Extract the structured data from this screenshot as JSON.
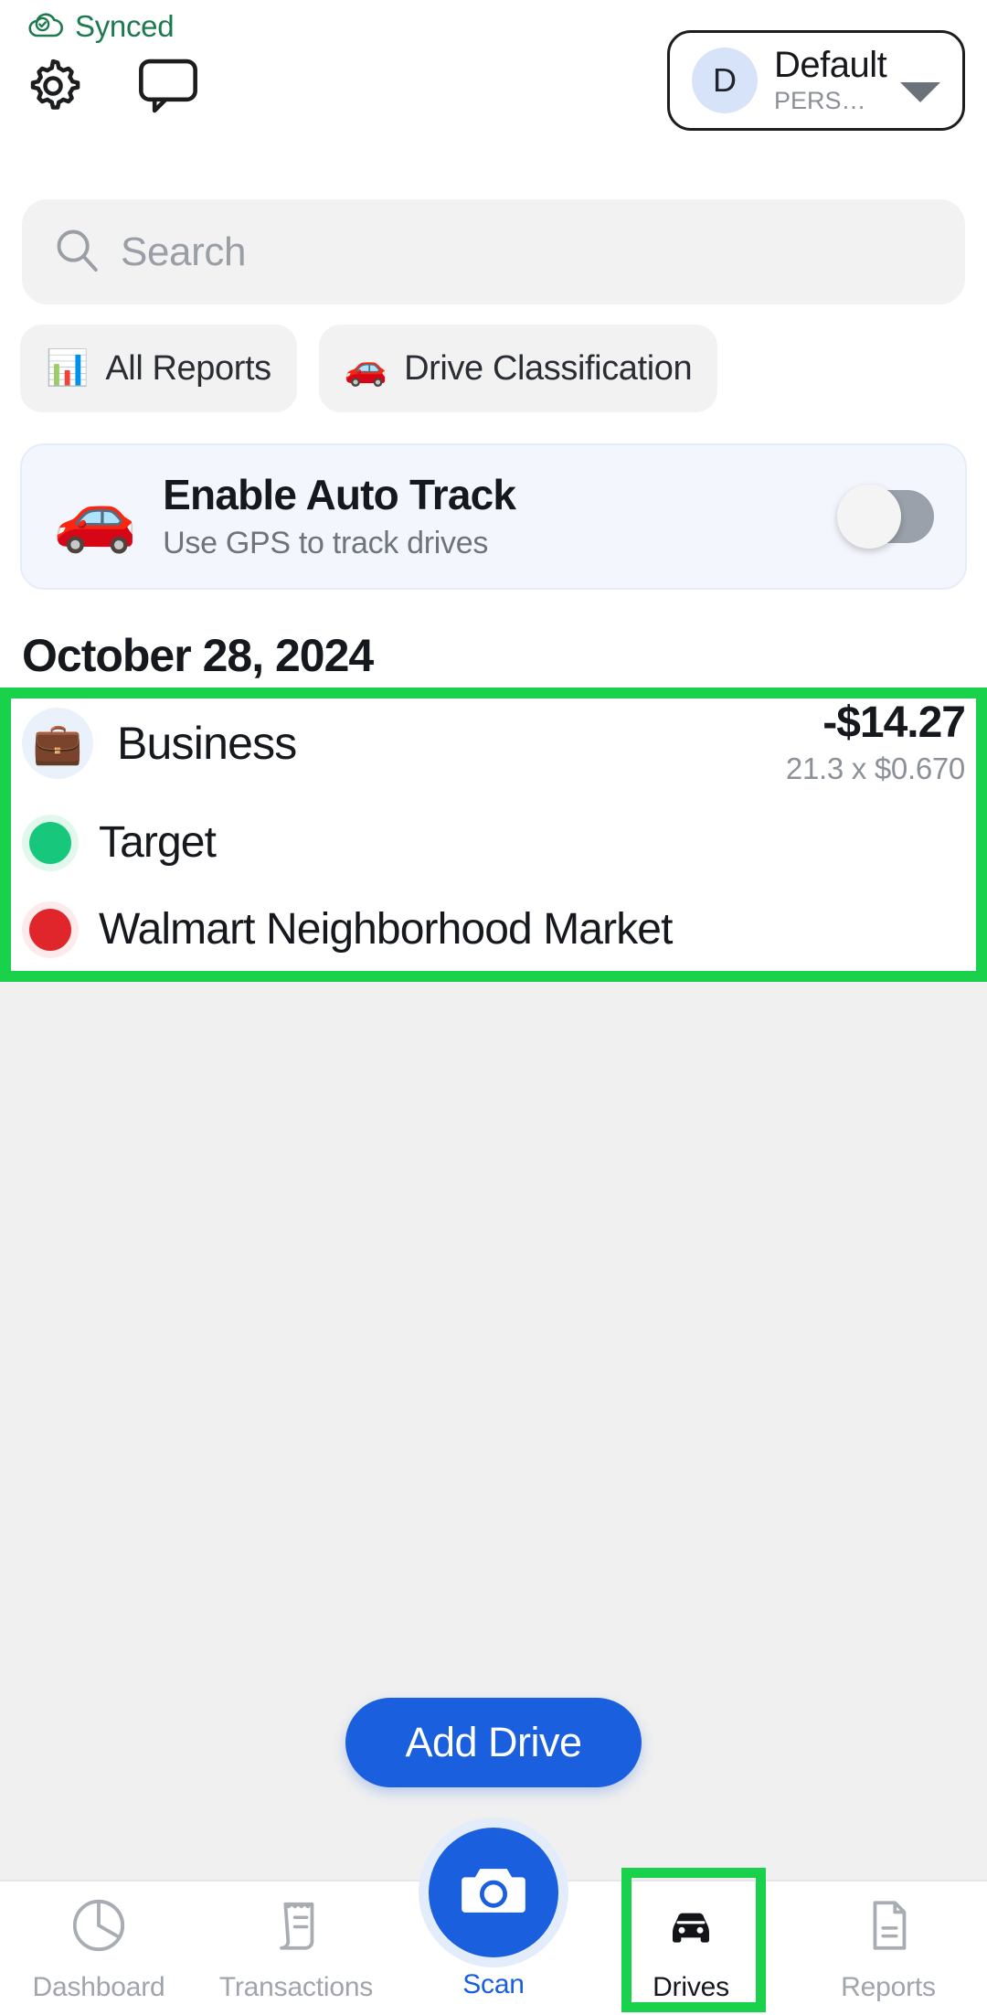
{
  "header": {
    "sync_status": "Synced",
    "sync_icon": "cloud-check-icon",
    "settings_icon": "gear-icon",
    "chat_icon": "chat-bubble-icon",
    "account": {
      "avatar_initial": "D",
      "name": "Default",
      "subtitle": "PERS…",
      "caret_icon": "chevron-down-icon"
    }
  },
  "search": {
    "placeholder": "Search",
    "value": "",
    "icon": "search-icon"
  },
  "chips": [
    {
      "label": "All Reports",
      "emoji": "📊",
      "icon": "bar-chart-icon"
    },
    {
      "label": "Drive Classification",
      "emoji": "🚗",
      "icon": "car-icon"
    }
  ],
  "auto_track": {
    "emoji": "🚗",
    "title": "Enable Auto Track",
    "subtitle": "Use GPS to track drives",
    "toggle_state": "off"
  },
  "drives": {
    "date_header": "October 28, 2024",
    "entry": {
      "category": "Business",
      "category_emoji": "💼",
      "amount": "-$14.27",
      "rate_detail": "21.3 x $0.670",
      "start_stop": "Target",
      "end_stop": "Walmart Neighborhood Market"
    }
  },
  "actions": {
    "add_drive_label": "Add Drive"
  },
  "bottom_nav": {
    "items": [
      {
        "label": "Dashboard",
        "icon": "pie-chart-icon",
        "active": false
      },
      {
        "label": "Transactions",
        "icon": "receipt-icon",
        "active": false
      },
      {
        "label": "Scan",
        "icon": "camera-icon",
        "active": false
      },
      {
        "label": "Drives",
        "icon": "car-front-icon",
        "active": true
      },
      {
        "label": "Reports",
        "icon": "document-icon",
        "active": false
      }
    ]
  },
  "colors": {
    "accent_blue": "#1a5fde",
    "sync_green": "#1d7a4f",
    "highlight_green": "#19d14b",
    "start_dot": "#16c77c",
    "end_dot": "#e0262b",
    "page_bg": "#f0f0f0"
  }
}
